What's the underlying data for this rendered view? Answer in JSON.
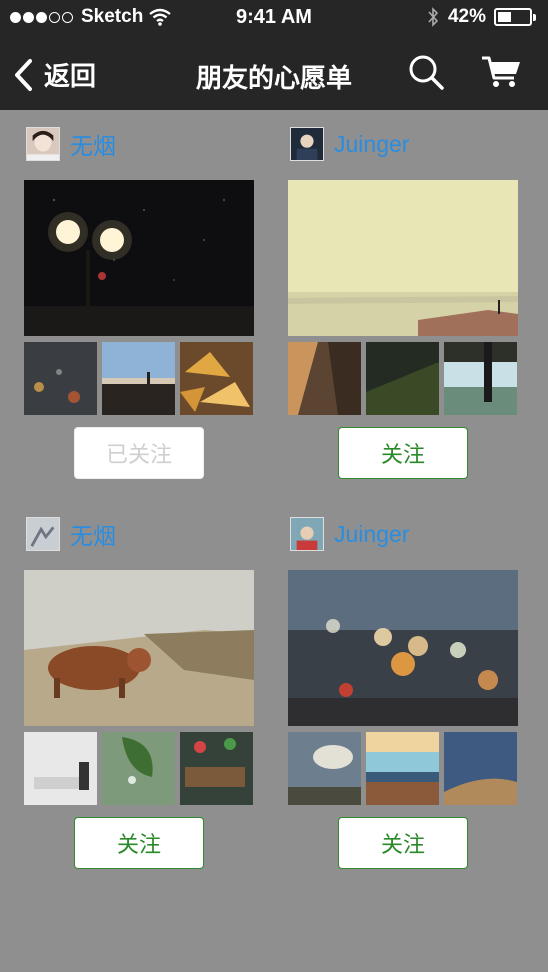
{
  "status_bar": {
    "carrier": "Sketch",
    "time": "9:41 AM",
    "battery": "42%",
    "battery_level": 0.42,
    "signal_bars_filled": 3,
    "signal_bars_total": 5
  },
  "nav": {
    "back_label": "返回",
    "title": "朋友的心愿单"
  },
  "colors": {
    "header_bg": "#262626",
    "page_bg": "#8f8f8f",
    "username": "#2a8de0",
    "follow_green": "#2a8a2a"
  },
  "cards": [
    {
      "username": "无烟",
      "follow_label": "已关注",
      "followed": true
    },
    {
      "username": "Juinger",
      "follow_label": "关注",
      "followed": false
    },
    {
      "username": "无烟",
      "follow_label": "关注",
      "followed": false
    },
    {
      "username": "Juinger",
      "follow_label": "关注",
      "followed": false
    }
  ]
}
